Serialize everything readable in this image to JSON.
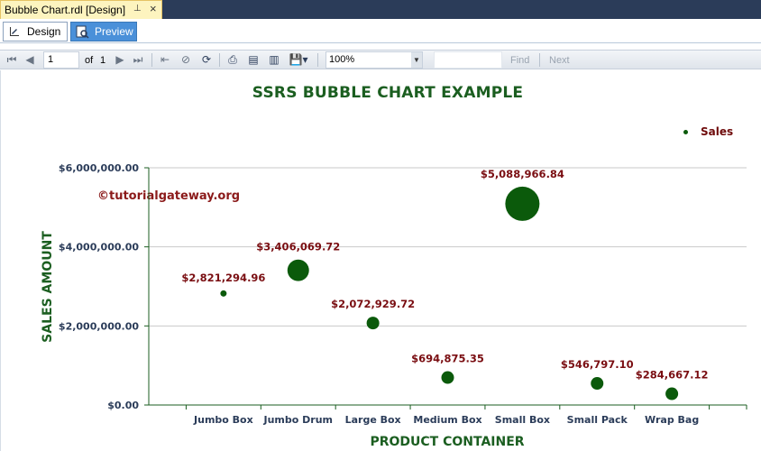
{
  "window": {
    "doc_tab_title": "Bubble Chart.rdl [Design]",
    "pin_glyph": "⊥",
    "close_glyph": "×"
  },
  "view_tabs": {
    "design_label": "Design",
    "preview_label": "Preview",
    "active": "Preview"
  },
  "toolbar": {
    "page_current": "1",
    "page_of_label": "of",
    "page_total": "1",
    "zoom_value": "100%",
    "find_label": "Find",
    "next_label": "Next"
  },
  "report": {
    "watermark": "©tutorialgateway.org"
  },
  "chart_data": {
    "type": "scatter",
    "subtype": "bubble",
    "title": "SSRS BUBBLE CHART EXAMPLE",
    "xlabel": "PRODUCT CONTAINER",
    "ylabel": "SALES AMOUNT",
    "categories": [
      "Jumbo Box",
      "Jumbo Drum",
      "Large Box",
      "Medium Box",
      "Small Box",
      "Small Pack",
      "Wrap Bag"
    ],
    "series": [
      {
        "name": "Sales",
        "color": "#0b5a0b",
        "values": [
          2821294.96,
          3406069.72,
          2072929.72,
          694875.35,
          5088966.84,
          546797.1,
          284667.12
        ],
        "labels": [
          "$2,821,294.96",
          "$3,406,069.72",
          "$2,072,929.72",
          "$694,875.35",
          "$5,088,966.84",
          "$546,797.10",
          "$284,667.12"
        ],
        "bubble_size": [
          1,
          4,
          2,
          2,
          8,
          2,
          2
        ]
      }
    ],
    "ylim": [
      0,
      6000000
    ],
    "yticks": [
      0,
      2000000,
      4000000,
      6000000
    ],
    "ytick_labels": [
      "$0.00",
      "$2,000,000.00",
      "$4,000,000.00",
      "$6,000,000.00"
    ],
    "grid": true,
    "legend_position": "top-right",
    "label_color": "#7a0e12",
    "title_color": "#1b5e20"
  }
}
